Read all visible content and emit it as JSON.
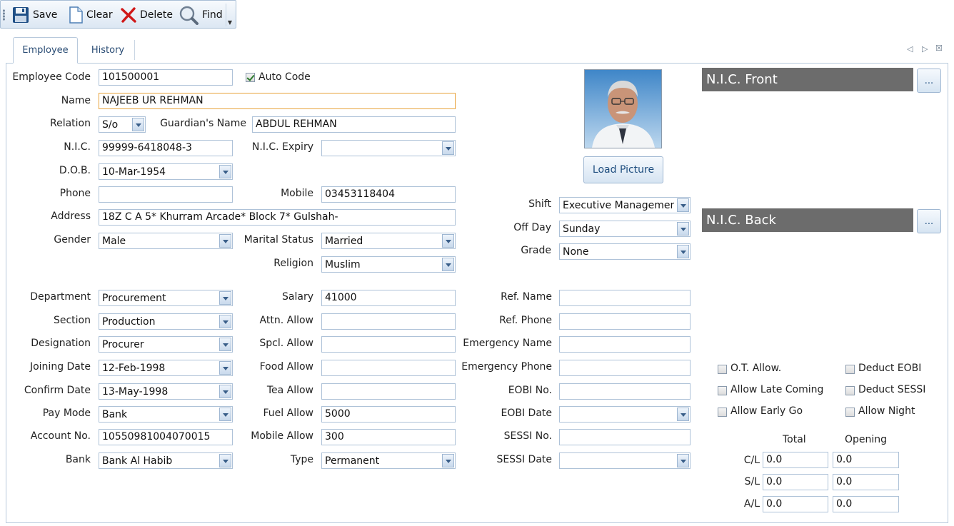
{
  "toolbar": {
    "save": "Save",
    "clear": "Clear",
    "delete": "Delete",
    "find": "Find"
  },
  "tabs": {
    "employee": "Employee",
    "history": "History"
  },
  "tab_nav": {
    "prev": "◁",
    "next": "▷",
    "close": "☒"
  },
  "labels": {
    "employee_code": "Employee Code",
    "auto_code": "Auto Code",
    "name": "Name",
    "relation": "Relation",
    "guardians_name": "Guardian's Name",
    "nic": "N.I.C.",
    "nic_expiry": "N.I.C. Expiry",
    "dob": "D.O.B.",
    "phone": "Phone",
    "mobile": "Mobile",
    "address": "Address",
    "gender": "Gender",
    "marital_status": "Marital Status",
    "religion": "Religion",
    "shift": "Shift",
    "off_day": "Off Day",
    "grade": "Grade",
    "department": "Department",
    "section": "Section",
    "designation": "Designation",
    "joining_date": "Joining Date",
    "confirm_date": "Confirm Date",
    "pay_mode": "Pay Mode",
    "account_no": "Account No.",
    "bank": "Bank",
    "salary": "Salary",
    "attn_allow": "Attn. Allow",
    "spcl_allow": "Spcl. Allow",
    "food_allow": "Food Allow",
    "tea_allow": "Tea Allow",
    "fuel_allow": "Fuel Allow",
    "mobile_allow": "Mobile Allow",
    "type": "Type",
    "ref_name": "Ref. Name",
    "ref_phone": "Ref. Phone",
    "emergency_name": "Emergency Name",
    "emergency_phone": "Emergency Phone",
    "eobi_no": "EOBI No.",
    "eobi_date": "EOBI Date",
    "sessi_no": "SESSI No.",
    "sessi_date": "SESSI Date",
    "load_picture": "Load Picture",
    "nic_front": "N.I.C. Front",
    "nic_back": "N.I.C. Back",
    "browse": "...",
    "ot_allow": "O.T. Allow.",
    "deduct_eobi": "Deduct EOBI",
    "allow_late_coming": "Allow Late Coming",
    "deduct_sessi": "Deduct SESSI",
    "allow_early_go": "Allow Early Go",
    "allow_night": "Allow Night",
    "total": "Total",
    "opening": "Opening",
    "cl": "C/L",
    "sl": "S/L",
    "al": "A/L"
  },
  "values": {
    "employee_code": "101500001",
    "auto_code_checked": true,
    "name": "NAJEEB UR REHMAN",
    "relation": "S/o",
    "guardians_name": "ABDUL REHMAN",
    "nic": "99999-6418048-3",
    "nic_expiry": "",
    "dob": "10-Mar-1954",
    "phone": "",
    "mobile": "03453118404",
    "address": "18Z C A 5* Khurram Arcade* Block 7* Gulshah-",
    "gender": "Male",
    "marital_status": "Married",
    "religion": "Muslim",
    "shift": "Executive Management",
    "off_day": "Sunday",
    "grade": "None",
    "department": "Procurement",
    "section": "Production",
    "designation": "Procurer",
    "joining_date": "12-Feb-1998",
    "confirm_date": "13-May-1998",
    "pay_mode": "Bank",
    "account_no": "10550981004070015",
    "bank": "Bank Al Habib",
    "salary": "41000",
    "attn_allow": "",
    "spcl_allow": "",
    "food_allow": "",
    "tea_allow": "",
    "fuel_allow": "5000",
    "mobile_allow": "300",
    "type": "Permanent",
    "ref_name": "",
    "ref_phone": "",
    "emergency_name": "",
    "emergency_phone": "",
    "eobi_no": "",
    "eobi_date": "",
    "sessi_no": "",
    "sessi_date": "",
    "cl_total": "0.0",
    "cl_opening": "0.0",
    "sl_total": "0.0",
    "sl_opening": "0.0",
    "al_total": "0.0",
    "al_opening": "0.0"
  },
  "colors": {
    "accent": "#2b4d75",
    "nic_bar": "#6c6c6c",
    "focus_border": "#e8a23a",
    "delete_red": "#d01818"
  }
}
